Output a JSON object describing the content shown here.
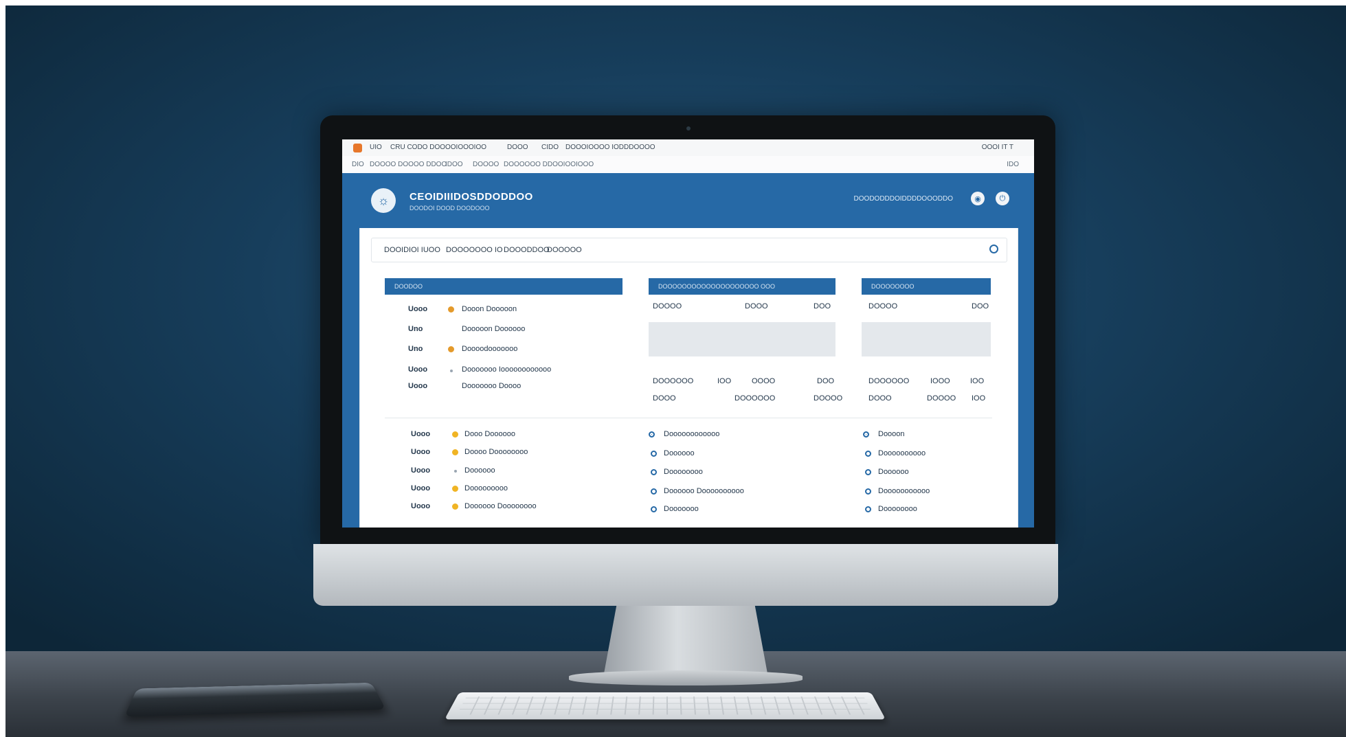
{
  "scene": {
    "colors": {
      "background": "#173e5c",
      "accent": "#2669a6",
      "desk": "#4a525b"
    }
  },
  "browser": {
    "tabs": [
      "UIO",
      "CRU CODO DOOOOIOOOIOO",
      "DOOO",
      "CIDO",
      "DOOOIOOOO IODDDOOOO"
    ],
    "tab_right": "OOOI IT T",
    "address_items": [
      "DIO",
      "DOOOO DOOOO DDOO",
      "IDOO",
      "DOOOO",
      "DOOOOOO DDOOIOO",
      "IOOO"
    ],
    "address_right": "IDO"
  },
  "header": {
    "brand": "CEOIDIIIDOSDDODDOO",
    "tagline": "DOODOI DOOD DOODOOO",
    "right_text": "DOODODDDOIDDDDOOODDO"
  },
  "filters": [
    "DOOIDIOI IUOO",
    "DOOOOOOO IO",
    "DOOODDOO",
    "DOOOOO"
  ],
  "panel_left": {
    "title": "DOODOO",
    "rows": [
      {
        "code": "Uooo",
        "label": "Dooon Dooooon",
        "marker": "orange"
      },
      {
        "code": "Uno",
        "label": "Dooooon Doooooo",
        "marker": "none"
      },
      {
        "code": "Uno",
        "label": "Doooodooooooo",
        "marker": "orange"
      },
      {
        "code": "Uooo",
        "label": "Dooooooo Ioooooooooooo",
        "marker": "small"
      },
      {
        "code": "Uooo",
        "label": "Dooooooo Doooo",
        "marker": "none"
      }
    ]
  },
  "panel_mid": {
    "title": "DOOOOOOOOOOOOOOOOOOOO     OOO",
    "cols": [
      "DOOOO",
      "DOOO",
      "DOO"
    ],
    "row1": [
      "DOOOOOO",
      "IOO",
      "OOOO",
      "DOO"
    ],
    "row2": [
      "DOOO",
      "DOOOOOO",
      "DOOOO"
    ]
  },
  "panel_right": {
    "title": "DOOOOOOOO",
    "cols": [
      "DOOOO",
      "DOO"
    ],
    "row1": [
      "DOOOOOO",
      "IOOO",
      "IOO"
    ],
    "row2": [
      "DOOO",
      "DOOOO",
      "IOO"
    ]
  },
  "bottom_left": [
    {
      "code": "Uooo",
      "label": "Dooo Doooooo",
      "marker": "yellow"
    },
    {
      "code": "Uooo",
      "label": "Doooo Doooooooo",
      "marker": "yellow"
    },
    {
      "code": "Uooo",
      "label": "Doooooo",
      "marker": "small"
    },
    {
      "code": "Uooo",
      "label": "Dooooooooo",
      "marker": "yellow"
    },
    {
      "code": "Uooo",
      "label": "Doooooo Doooooooo",
      "marker": "yellow"
    }
  ],
  "bottom_mid": [
    {
      "label": "Doooooooooooo",
      "filled": true
    },
    {
      "label": "Doooooo",
      "filled": false
    },
    {
      "label": "Doooooooo",
      "filled": false
    },
    {
      "label": "Doooooo Doooooooooo",
      "filled": false
    },
    {
      "label": "Dooooooo",
      "filled": false
    }
  ],
  "bottom_right": [
    {
      "label": "Doooon",
      "filled": true
    },
    {
      "label": "Doooooooooo",
      "filled": false
    },
    {
      "label": "Doooooo",
      "filled": false
    },
    {
      "label": "Dooooooooooo",
      "filled": false
    },
    {
      "label": "Doooooooo",
      "filled": false
    }
  ]
}
